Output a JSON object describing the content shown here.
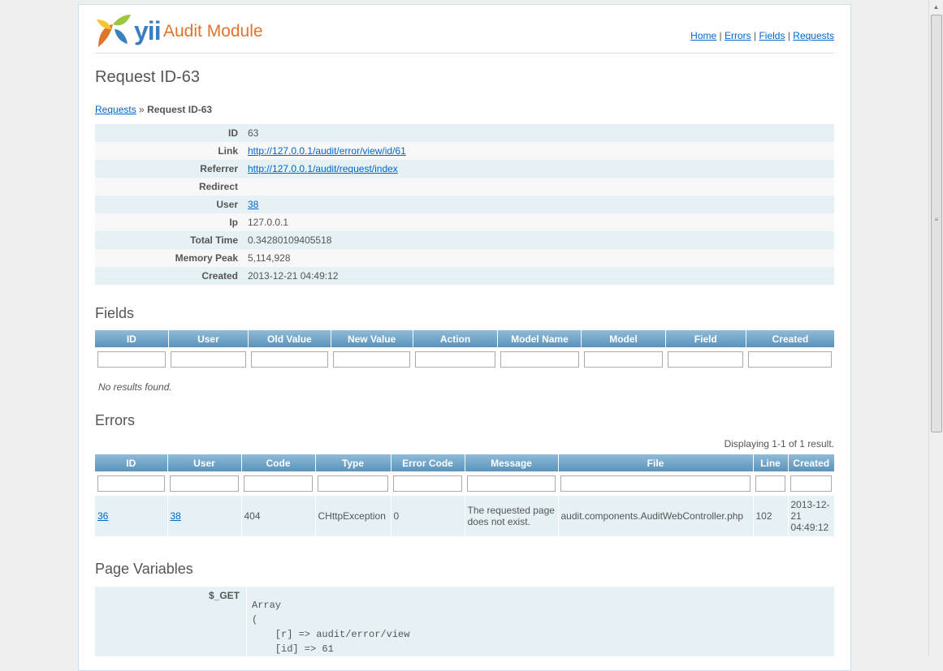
{
  "app": {
    "logo_text": "yii",
    "module_title": "Audit Module"
  },
  "mainmenu": {
    "home": "Home",
    "errors": "Errors",
    "fields": "Fields",
    "requests": "Requests",
    "sep": "|"
  },
  "page": {
    "title": "Request ID-63"
  },
  "breadcrumbs": {
    "parent": "Requests",
    "sep": "»",
    "current": "Request ID-63"
  },
  "detail": [
    {
      "label": "ID",
      "value": "63",
      "link": false
    },
    {
      "label": "Link",
      "value": "http://127.0.0.1/audit/error/view/id/61",
      "link": true
    },
    {
      "label": "Referrer",
      "value": "http://127.0.0.1/audit/request/index",
      "link": true
    },
    {
      "label": "Redirect",
      "value": "",
      "link": false
    },
    {
      "label": "User",
      "value": "38",
      "link": true
    },
    {
      "label": "Ip",
      "value": "127.0.0.1",
      "link": false
    },
    {
      "label": "Total Time",
      "value": "0.34280109405518",
      "link": false
    },
    {
      "label": "Memory Peak",
      "value": "5,114,928",
      "link": false
    },
    {
      "label": "Created",
      "value": "2013-12-21 04:49:12",
      "link": false
    }
  ],
  "fields": {
    "heading": "Fields",
    "columns": [
      "ID",
      "User",
      "Old Value",
      "New Value",
      "Action",
      "Model Name",
      "Model",
      "Field",
      "Created"
    ],
    "empty": "No results found."
  },
  "errors": {
    "heading": "Errors",
    "summary": "Displaying 1-1 of 1 result.",
    "columns": [
      "ID",
      "User",
      "Code",
      "Type",
      "Error Code",
      "Message",
      "File",
      "Line",
      "Created"
    ],
    "row": {
      "id": "36",
      "user": "38",
      "code": "404",
      "type": "CHttpException",
      "error_code": "0",
      "message": "The requested page does not exist.",
      "file": "audit.components.AuditWebController.php",
      "line": "102",
      "created": "2013-12-21 04:49:12"
    }
  },
  "page_variables": {
    "heading": "Page Variables",
    "label": "$_GET",
    "value": "Array\n(\n    [r] => audit/error/view\n    [id] => 61"
  },
  "colors": {
    "accent_link": "#0066cc",
    "row_odd": "#e5f1f4",
    "header_grad_top": "#8fbbd7",
    "header_grad_bottom": "#5a93bc",
    "logo_orange": "#e0742b",
    "logo_blue": "#3a7fbf"
  }
}
